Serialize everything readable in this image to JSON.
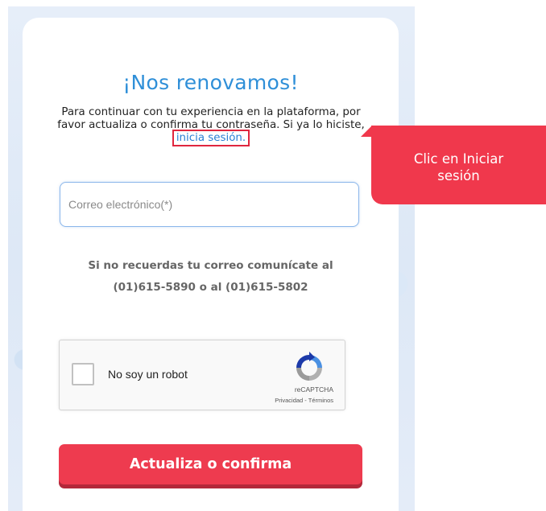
{
  "heading": "¡Nos renovamos!",
  "intro": {
    "text": "Para continuar con tu experiencia en la plataforma, por favor actualiza o confirma tu contraseña. Si ya lo hiciste,",
    "link_label": "inicia sesión."
  },
  "email": {
    "placeholder": "Correo electrónico(*)",
    "value": ""
  },
  "help": {
    "line1": "Si no recuerdas tu correo comunícate al",
    "line2": "(01)615-5890 o al (01)615-5802"
  },
  "recaptcha": {
    "label": "No soy un robot",
    "brand": "reCAPTCHA",
    "terms": "Privacidad - Términos",
    "checked": false
  },
  "submit_label": "Actualiza o confirma",
  "callout": {
    "line1": "Clic en Iniciar",
    "line2": "sesión"
  },
  "colors": {
    "accent_blue": "#2f8fd8",
    "primary_red": "#ee3b4f",
    "callout_red": "#f0384c"
  }
}
